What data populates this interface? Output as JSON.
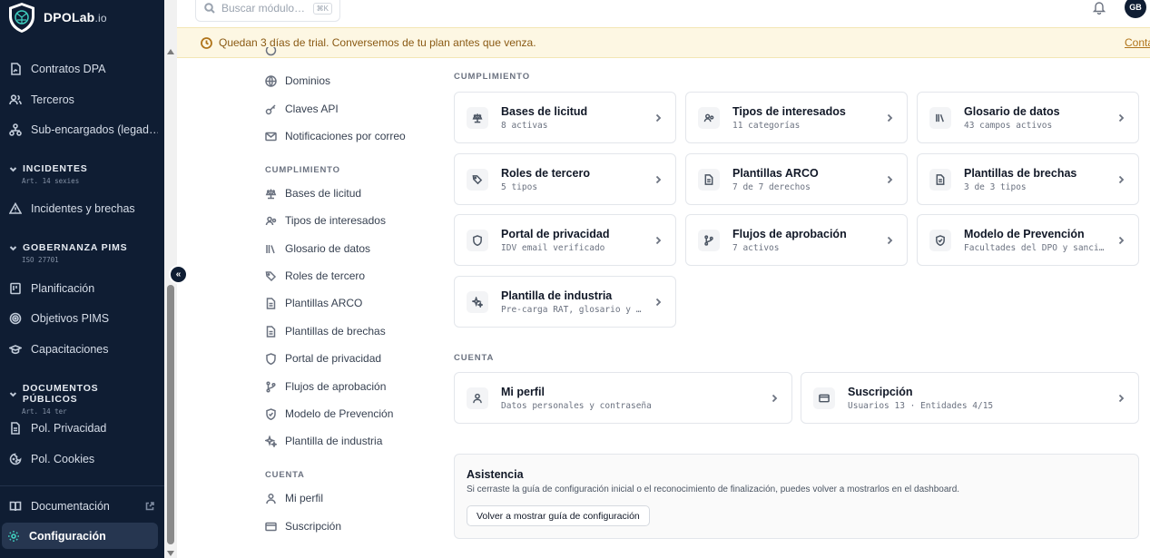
{
  "app": {
    "logo_name": "DPOLab",
    "logo_suffix": ".io"
  },
  "sidebar": {
    "items_top": [
      {
        "label": "Contratos DPA",
        "icon": "file-signature-icon"
      },
      {
        "label": "Terceros",
        "icon": "users-icon"
      },
      {
        "label": "Sub-encargados (legad…",
        "icon": "network-icon"
      }
    ],
    "sections": [
      {
        "title": "INCIDENTES",
        "subtitle": "Art. 14 sexies",
        "items": [
          {
            "label": "Incidentes y brechas",
            "icon": "alert-triangle-icon"
          }
        ]
      },
      {
        "title": "GOBERNANZA PIMS",
        "subtitle": "ISO 27701",
        "items": [
          {
            "label": "Planificación",
            "icon": "plan-icon"
          },
          {
            "label": "Objetivos PIMS",
            "icon": "target-icon"
          },
          {
            "label": "Capacitaciones",
            "icon": "graduation-icon"
          }
        ]
      },
      {
        "title": "DOCUMENTOS PÚBLICOS",
        "subtitle": "Art. 14 ter",
        "items": [
          {
            "label": "Pol. Privacidad",
            "icon": "document-icon"
          },
          {
            "label": "Pol. Cookies",
            "icon": "cookie-icon"
          }
        ]
      }
    ],
    "documentation": "Documentación",
    "settings": "Configuración",
    "collapse_label": "«"
  },
  "topbar": {
    "search_placeholder": "Buscar módulo…",
    "search_shortcut": "⌘K",
    "avatar_initials": "GB"
  },
  "trial_banner": {
    "message": "Quedan 3 días de trial. Conversemos de tu plan antes que venza.",
    "link": "Conta"
  },
  "settings_nav": {
    "general_items": [
      "Dominios",
      "Claves API",
      "Notificaciones por correo"
    ],
    "cumplimiento_title": "CUMPLIMIENTO",
    "cumplimiento_items": [
      "Bases de licitud",
      "Tipos de interesados",
      "Glosario de datos",
      "Roles de tercero",
      "Plantillas ARCO",
      "Plantillas de brechas",
      "Portal de privacidad",
      "Flujos de aprobación",
      "Modelo de Prevención",
      "Plantilla de industria"
    ],
    "cuenta_title": "CUENTA",
    "cuenta_items": [
      "Mi perfil",
      "Suscripción"
    ]
  },
  "content": {
    "cumplimiento_title": "CUMPLIMIENTO",
    "cards": [
      {
        "title": "Bases de licitud",
        "subtitle": "8 activas",
        "icon": "scale-icon"
      },
      {
        "title": "Tipos de interesados",
        "subtitle": "11 categorías",
        "icon": "users-icon"
      },
      {
        "title": "Glosario de datos",
        "subtitle": "43 campos activos",
        "icon": "library-icon"
      },
      {
        "title": "Roles de tercero",
        "subtitle": "5 tipos",
        "icon": "tags-icon"
      },
      {
        "title": "Plantillas ARCO",
        "subtitle": "7 de 7 derechos",
        "icon": "document-icon"
      },
      {
        "title": "Plantillas de brechas",
        "subtitle": "3 de 3 tipos",
        "icon": "document-icon"
      },
      {
        "title": "Portal de privacidad",
        "subtitle": "IDV email verificado",
        "icon": "shield-icon"
      },
      {
        "title": "Flujos de aprobación",
        "subtitle": "7 activos",
        "icon": "branch-icon"
      },
      {
        "title": "Modelo de Prevención",
        "subtitle": "Facultades del DPO y sancion…",
        "icon": "shield-check-icon"
      },
      {
        "title": "Plantilla de industria",
        "subtitle": "Pre-carga RAT, glosario y te…",
        "icon": "sparkles-icon"
      }
    ],
    "cuenta_title": "CUENTA",
    "account_cards": [
      {
        "title": "Mi perfil",
        "subtitle": "Datos personales y contraseña",
        "icon": "user-icon"
      },
      {
        "title": "Suscripción",
        "subtitle": "Usuarios 13 · Entidades 4/15",
        "icon": "credit-card-icon"
      }
    ],
    "assist": {
      "title": "Asistencia",
      "description": "Si cerraste la guía de configuración inicial o el reconocimiento de finalización, puedes volver a mostrarlos en el dashboard.",
      "button": "Volver a mostrar guía de configuración"
    }
  },
  "colors": {
    "sidebar_bg": "#0f1d33",
    "accent": "#3fd0c0",
    "trial_bg": "#fdf7e3",
    "trial_text": "#8a5a14"
  }
}
